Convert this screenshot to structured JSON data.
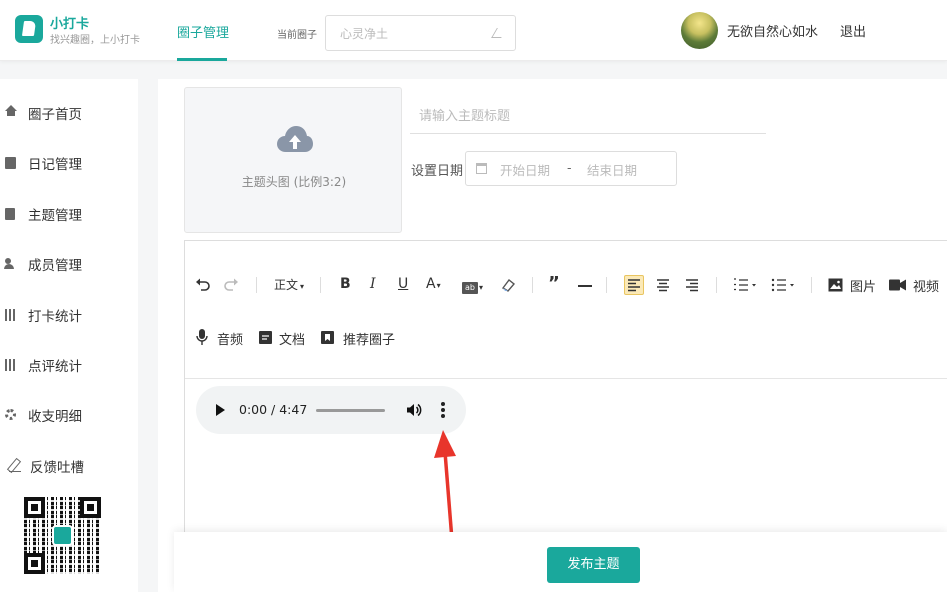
{
  "brand": {
    "name": "小打卡",
    "slogan": "找兴趣圈，上小打卡",
    "accent": "#1aa89c"
  },
  "nav": {
    "active_tab": "圈子管理"
  },
  "circle": {
    "label": "当前圈子",
    "value": "心灵净土"
  },
  "user": {
    "name": "无欲自然心如水",
    "logout": "退出"
  },
  "sidebar": {
    "items": [
      {
        "label": "圈子首页",
        "icon": "home-icon"
      },
      {
        "label": "日记管理",
        "icon": "book-icon"
      },
      {
        "label": "主题管理",
        "icon": "document-icon"
      },
      {
        "label": "成员管理",
        "icon": "member-icon"
      },
      {
        "label": "打卡统计",
        "icon": "bar-chart-icon"
      },
      {
        "label": "点评统计",
        "icon": "bar-chart-icon"
      },
      {
        "label": "收支明细",
        "icon": "gear-icon"
      },
      {
        "label": "反馈吐槽",
        "icon": "pen-icon"
      }
    ]
  },
  "form": {
    "cover_upload": "主题头图 (比例3:2)",
    "title_placeholder": "请输入主题标题",
    "date_label": "设置日期",
    "date_start_placeholder": "开始日期",
    "date_separator": "-",
    "date_end_placeholder": "结束日期"
  },
  "toolbar": {
    "heading": "正文",
    "image": "图片",
    "video": "视频",
    "audio": "音频",
    "document": "文档",
    "recommend": "推荐圈子"
  },
  "audio_player": {
    "time": "0:00 / 4:47"
  },
  "footer": {
    "publish": "发布主题"
  }
}
